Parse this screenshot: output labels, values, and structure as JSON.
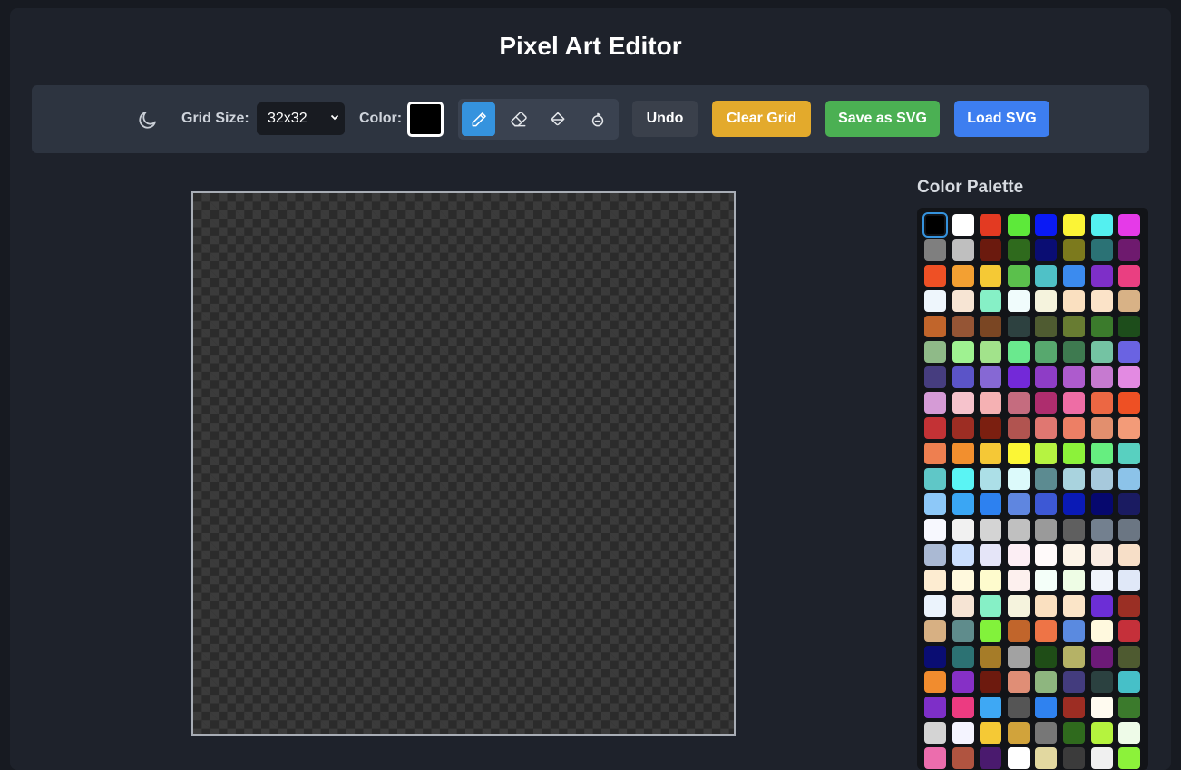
{
  "app": {
    "title": "Pixel Art Editor"
  },
  "toolbar": {
    "theme_icon": "moon-icon",
    "grid_size_label": "Grid Size:",
    "grid_size_value": "32x32",
    "color_label": "Color:",
    "current_color": "#000000",
    "tools": [
      {
        "name": "pencil",
        "icon": "pencil-icon",
        "active": true
      },
      {
        "name": "eraser",
        "icon": "eraser-icon",
        "active": false
      },
      {
        "name": "fill",
        "icon": "fill-bucket-icon",
        "active": false
      },
      {
        "name": "eyedropper",
        "icon": "eyedropper-icon",
        "active": false
      }
    ],
    "undo_label": "Undo",
    "clear_label": "Clear Grid",
    "save_label": "Save as SVG",
    "load_label": "Load SVG"
  },
  "canvas": {
    "grid_size": 32
  },
  "palette": {
    "title": "Color Palette",
    "selected_index": 0,
    "colors": [
      "#000000",
      "#ffffff",
      "#e33a22",
      "#5de93a",
      "#0a1af5",
      "#fbf436",
      "#54f0f0",
      "#e53ae8",
      "#7f7f7f",
      "#bfbfbf",
      "#6b1a0e",
      "#2f6a1d",
      "#0a0d73",
      "#7c7a1d",
      "#2b7275",
      "#6e1a6e",
      "#ee5025",
      "#f3a032",
      "#f5c935",
      "#5bc04c",
      "#4fc1c7",
      "#3b8bef",
      "#7e2fc8",
      "#ea3f81",
      "#eef6fc",
      "#f7e5d4",
      "#86f0c6",
      "#f0fcfc",
      "#f5f3dd",
      "#fae0c0",
      "#fbe3c8",
      "#d8b286",
      "#c1652b",
      "#955535",
      "#7a4623",
      "#2d4140",
      "#4f5b31",
      "#687c32",
      "#3b7b2c",
      "#1d4d1b",
      "#8fba88",
      "#9ff291",
      "#a2e38b",
      "#6ae98e",
      "#57a86e",
      "#3e7a50",
      "#74c3a3",
      "#6a63e2",
      "#463d7f",
      "#5b54c8",
      "#8668d4",
      "#7329d8",
      "#8e3dc6",
      "#ad5bcd",
      "#c67ad0",
      "#e38ae2",
      "#d59bd6",
      "#f6c3cc",
      "#f5b1b3",
      "#c56c7f",
      "#ae2d6e",
      "#ee6da5",
      "#ec6743",
      "#ee5024",
      "#c33235",
      "#9d2d23",
      "#7b1f10",
      "#b15450",
      "#e07771",
      "#ed7f65",
      "#e28f6e",
      "#f39b78",
      "#ee7f50",
      "#f28f2e",
      "#f5c836",
      "#fbf635",
      "#b6f341",
      "#8cf23a",
      "#66ee80",
      "#58d0c0",
      "#5fc7c7",
      "#5af4f4",
      "#acdfe7",
      "#dcfafb",
      "#5c8b91",
      "#a9d3de",
      "#a7c9dc",
      "#8cc3e9",
      "#8dc8f8",
      "#3aa6f4",
      "#2d81f0",
      "#5f86e0",
      "#3d58d5",
      "#0a1ab6",
      "#06086e",
      "#1a1b61",
      "#f7f8fe",
      "#f1f1f1",
      "#d4d4d4",
      "#c0c0c0",
      "#9a9a9a",
      "#5f5f5f",
      "#73808f",
      "#6b7683",
      "#aab9d3",
      "#cbdffd",
      "#e5e5f8",
      "#fceef4",
      "#fffafa",
      "#fcf4e8",
      "#f9ece2",
      "#f7dfc8",
      "#fdecd1",
      "#fff9dd",
      "#fefbcd",
      "#fdf0ee",
      "#f4fff9",
      "#eefde5",
      "#f0f4fb",
      "#e0e8f8",
      "#ebf3fc",
      "#f6e4d4",
      "#86f0c6",
      "#f5f3dd",
      "#fae0c0",
      "#fbe5c8",
      "#6c2ed6",
      "#9a2f24",
      "#d7b083",
      "#5f8c8c",
      "#82f23b",
      "#c1652b",
      "#ee7446",
      "#5a8ae0",
      "#fff9de",
      "#c5303a",
      "#0a0d73",
      "#2c7273",
      "#a67c28",
      "#a2a2a2",
      "#1f4d17",
      "#b5b266",
      "#6d1a78",
      "#4e5a30",
      "#f18c2e",
      "#8630c6",
      "#6d1a0e",
      "#e08e76",
      "#8eb67f",
      "#433c7e",
      "#2b4140",
      "#46c0c8",
      "#7e2fc8",
      "#ec3b81",
      "#3ea8f4",
      "#555555",
      "#2f82f0",
      "#9d2d23",
      "#fffbf0",
      "#3b7a2c",
      "#d4d4d4",
      "#f4f4ff",
      "#f5c935",
      "#d1a33b",
      "#777777",
      "#2f6a1d",
      "#b5f33e",
      "#eefbe8",
      "#ec6dad",
      "#b05440",
      "#4a1a6e",
      "#ffffff",
      "#e2d8a0",
      "#3b3b3b",
      "#f0f0f0",
      "#8cf23a"
    ]
  }
}
